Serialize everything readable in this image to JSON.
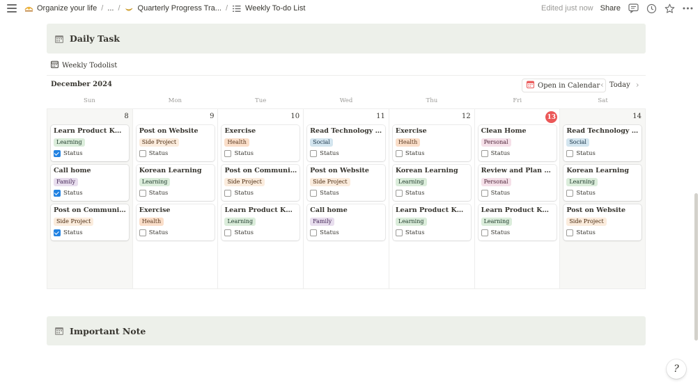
{
  "breadcrumb": {
    "items": [
      {
        "label": "Organize your life",
        "icon": "sunrise-icon"
      },
      {
        "label": "...",
        "icon": ""
      },
      {
        "label": "Quarterly Progress Tra...",
        "icon": "moon-icon"
      },
      {
        "label": "Weekly To-do List",
        "icon": "list-icon"
      }
    ],
    "separator": "/"
  },
  "topbar": {
    "edited": "Edited just now",
    "share": "Share"
  },
  "callouts": {
    "daily": "Daily Task",
    "important": "Important Note"
  },
  "database": {
    "title": "Weekly Todolist",
    "month": "December 2024",
    "open_calendar": "Open in Calendar",
    "today": "Today"
  },
  "weekdays": [
    "Sun",
    "Mon",
    "Tue",
    "Wed",
    "Thu",
    "Fri",
    "Sat"
  ],
  "days": [
    {
      "num": "8",
      "today": false,
      "cards": [
        {
          "title": "Learn Product Knowl...",
          "tag": "Learning",
          "status": "Status",
          "checked": true
        },
        {
          "title": "Call home",
          "tag": "Family",
          "status": "Status",
          "checked": true
        },
        {
          "title": "Post on Community",
          "tag": "Side Project",
          "status": "Status",
          "checked": true
        }
      ]
    },
    {
      "num": "9",
      "today": false,
      "cards": [
        {
          "title": "Post on Website",
          "tag": "Side Project",
          "status": "Status",
          "checked": false
        },
        {
          "title": "Korean Learning",
          "tag": "Learning",
          "status": "Status",
          "checked": false
        },
        {
          "title": "Exercise",
          "tag": "Health",
          "status": "Status",
          "checked": false
        }
      ]
    },
    {
      "num": "10",
      "today": false,
      "cards": [
        {
          "title": "Exercise",
          "tag": "Health",
          "status": "Status",
          "checked": false
        },
        {
          "title": "Post on Community",
          "tag": "Side Project",
          "status": "Status",
          "checked": false
        },
        {
          "title": "Learn Product Knowl...",
          "tag": "Learning",
          "status": "Status",
          "checked": false
        }
      ]
    },
    {
      "num": "11",
      "today": false,
      "cards": [
        {
          "title": "Read Technology News",
          "tag": "Social",
          "status": "Status",
          "checked": false
        },
        {
          "title": "Post on Website",
          "tag": "Side Project",
          "status": "Status",
          "checked": false
        },
        {
          "title": "Call home",
          "tag": "Family",
          "status": "Status",
          "checked": false
        }
      ]
    },
    {
      "num": "12",
      "today": false,
      "cards": [
        {
          "title": "Exercise",
          "tag": "Health",
          "status": "Status",
          "checked": false
        },
        {
          "title": "Korean Learning",
          "tag": "Learning",
          "status": "Status",
          "checked": false
        },
        {
          "title": "Learn Product Knowl...",
          "tag": "Learning",
          "status": "Status",
          "checked": false
        }
      ]
    },
    {
      "num": "13",
      "today": true,
      "cards": [
        {
          "title": "Clean Home",
          "tag": "Personal",
          "status": "Status",
          "checked": false
        },
        {
          "title": "Review and Plan for ...",
          "tag": "Personal",
          "status": "Status",
          "checked": false
        },
        {
          "title": "Learn Product Knowl...",
          "tag": "Learning",
          "status": "Status",
          "checked": false
        }
      ]
    },
    {
      "num": "14",
      "today": false,
      "cards": [
        {
          "title": "Read Technology News",
          "tag": "Social",
          "status": "Status",
          "checked": false
        },
        {
          "title": "Korean Learning",
          "tag": "Learning",
          "status": "Status",
          "checked": false
        },
        {
          "title": "Post on Website",
          "tag": "Side Project",
          "status": "Status",
          "checked": false
        }
      ]
    }
  ],
  "tag_colors": {
    "Learning": {
      "bg": "#dbeddb",
      "fg": "#1c3829"
    },
    "Family": {
      "bg": "#e8deee",
      "fg": "#412454"
    },
    "Side Project": {
      "bg": "#fbecdd",
      "fg": "#49290e"
    },
    "Health": {
      "bg": "#fadec9",
      "fg": "#5c3b23"
    },
    "Social": {
      "bg": "#d3e5ef",
      "fg": "#183347"
    },
    "Personal": {
      "bg": "#f5e0e9",
      "fg": "#4c2337"
    }
  },
  "colors": {
    "callout_bg": "#edf0ea",
    "today_badge": "#eb5757",
    "checkbox_on": "#2383e2"
  }
}
